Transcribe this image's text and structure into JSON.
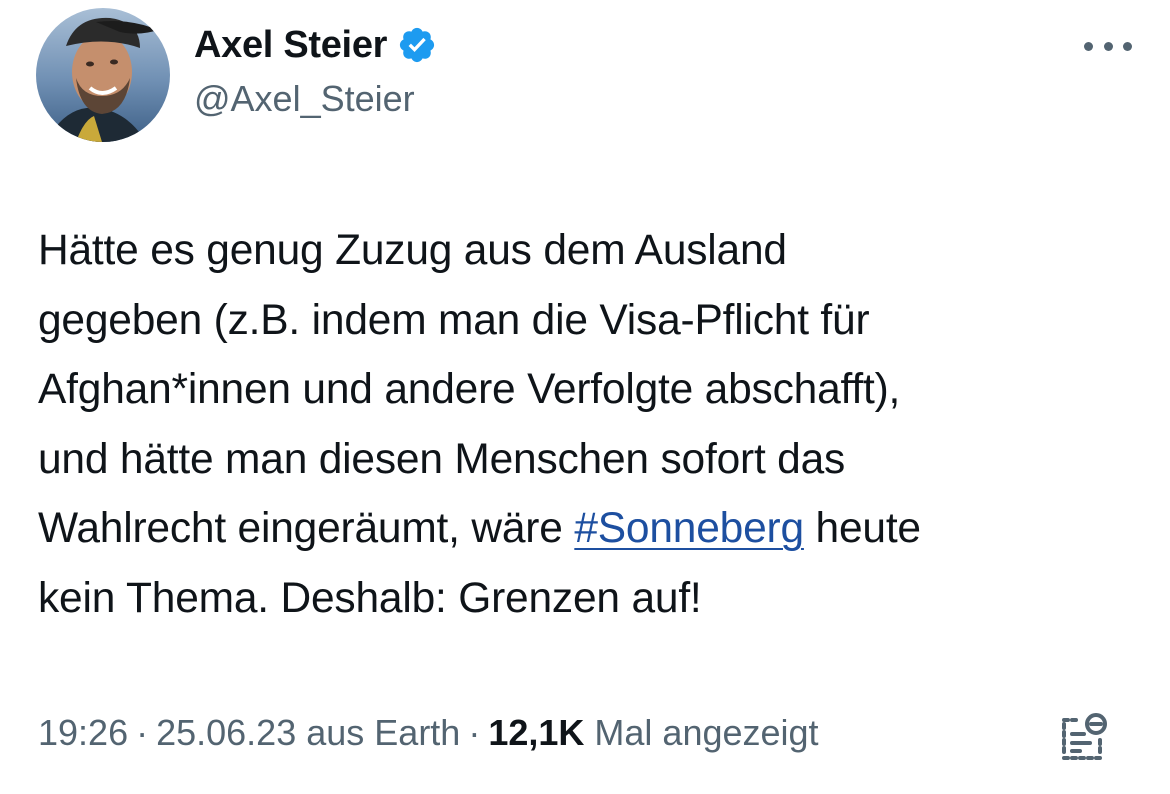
{
  "author": {
    "display_name": "Axel Steier",
    "handle": "@Axel_Steier",
    "verified_color": "#1d9bf0"
  },
  "tweet": {
    "lines": [
      "Hätte es genug Zuzug aus dem Ausland",
      "gegeben (z.B. indem man die Visa-Pflicht für",
      "Afghan*innen und andere Verfolgte abschafft),",
      "und hätte man diesen Menschen sofort das"
    ],
    "line5_before": "Wahlrecht eingeräumt, wäre ",
    "hashtag": "#Sonneberg",
    "line5_after": " heute",
    "line6": "kein Thema. Deshalb: Grenzen auf!"
  },
  "meta": {
    "time": "19:26",
    "separator": "·",
    "date": "25.06.23",
    "source": "aus Earth",
    "views_count": "12,1K",
    "views_label": "Mal angezeigt"
  },
  "icons": {
    "more": "more-horizontal-icon",
    "analytics": "view-analytics-icon",
    "verified": "verified-badge-icon"
  },
  "colors": {
    "link": "#1d4fa0",
    "secondary_text": "#536471",
    "primary_text": "#0f1419"
  }
}
